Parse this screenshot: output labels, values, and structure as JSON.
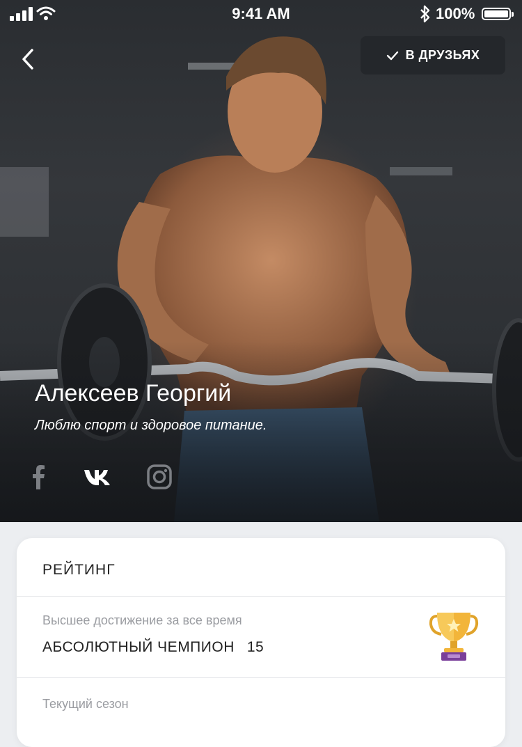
{
  "status_bar": {
    "time": "9:41 AM",
    "battery_text": "100%"
  },
  "header": {
    "friends_button_label": "В ДРУЗЬЯХ"
  },
  "profile": {
    "name": "Алексеев Георгий",
    "bio": "Люблю спорт и здоровое питание."
  },
  "social": [
    {
      "icon": "facebook-icon"
    },
    {
      "icon": "vk-icon"
    },
    {
      "icon": "instagram-icon"
    }
  ],
  "rating": {
    "title": "РЕЙТИНГ",
    "best": {
      "label": "Высшее достижение за все время",
      "value": "АБСОЛЮТНЫЙ ЧЕМПИОН",
      "count": "15",
      "icon": "trophy-icon"
    },
    "current": {
      "label": "Текущий сезон"
    }
  },
  "colors": {
    "accent": "#24272b",
    "trophy_gold": "#f2b53a",
    "trophy_base": "#7a3f9a"
  }
}
